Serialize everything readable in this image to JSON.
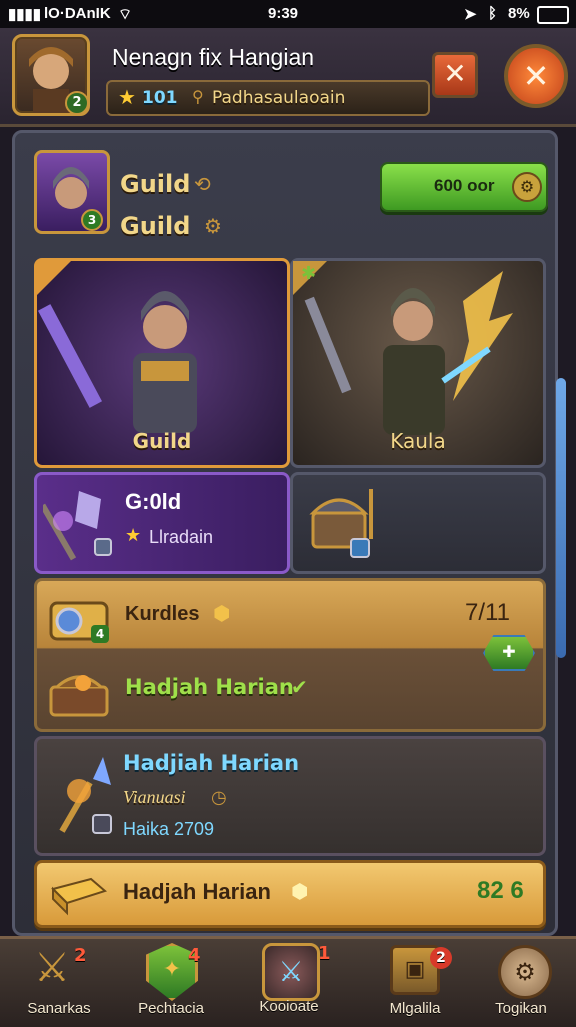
{
  "status_bar": {
    "carrier": "lO·DAnIK",
    "time": "9:39",
    "battery": "8%"
  },
  "header": {
    "title": "Nenagn fix Hangian",
    "player_level": "2",
    "stars": "101",
    "subtitle": "Padhasaulaoain"
  },
  "guild_panel": {
    "emblem_level": "3",
    "line1": "Guild",
    "line2": "Guild",
    "currency_button": "600 oor"
  },
  "hero_cards": [
    {
      "label": "Guild"
    },
    {
      "label": "Kaula"
    }
  ],
  "item_cards": [
    {
      "title": "G:0ld",
      "subtitle": "Llradain"
    },
    {
      "title": ""
    }
  ],
  "rewards": {
    "kurdles": {
      "label": "Kurdles",
      "count": "7/11",
      "chest_level": "4"
    },
    "daily": {
      "label": "Hadjah Harian"
    },
    "weapon_reward": {
      "title": "Hadjiah Harian",
      "line2": "Vianuasi",
      "line3": "Haika 2709"
    },
    "claim_bar": {
      "label": "Hadjah Harian",
      "value": "82 6"
    }
  },
  "bottom_nav": [
    {
      "label": "Sanarkas",
      "badge": "2"
    },
    {
      "label": "Pechtacia",
      "badge": "4"
    },
    {
      "label": "Kooioate",
      "badge": "1"
    },
    {
      "label": "Mlgalila",
      "badge": "2"
    },
    {
      "label": "Togikan",
      "badge": ""
    }
  ],
  "colors": {
    "gold": "#c8963c",
    "green": "#7cc13a",
    "purple": "#5a2e8a",
    "panel": "#34353f"
  }
}
